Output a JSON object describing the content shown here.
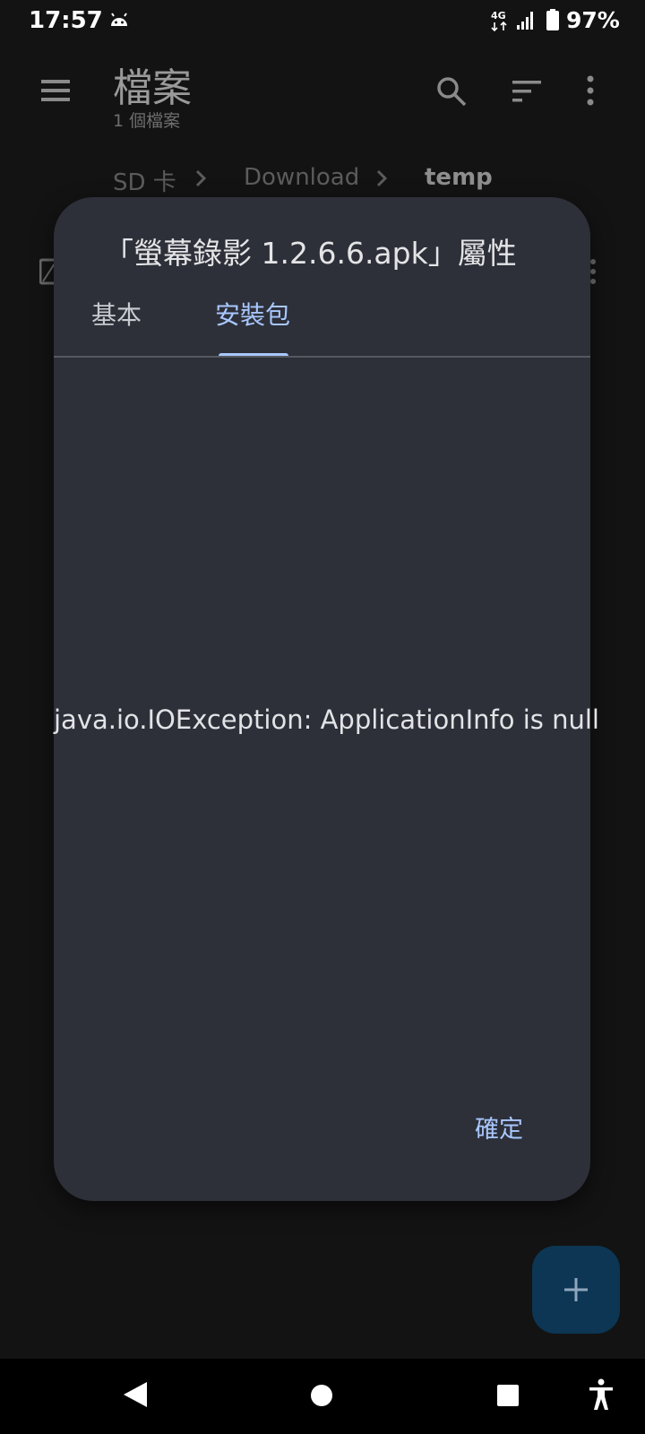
{
  "status_bar": {
    "time": "17:57",
    "network": "4G",
    "battery_percent": "97%"
  },
  "app_bar": {
    "title": "檔案",
    "subtitle": "1 個檔案"
  },
  "breadcrumb": {
    "items": [
      "SD 卡",
      "Download",
      "temp"
    ]
  },
  "dialog": {
    "title": "「螢幕錄影 1.2.6.6.apk」屬性",
    "tabs": [
      {
        "label": "基本",
        "selected": false
      },
      {
        "label": "安裝包",
        "selected": true
      }
    ],
    "message": "java.io.IOException: ApplicationInfo is null",
    "ok_label": "確定"
  },
  "colors": {
    "accent": "#a9c7ff",
    "dialog_bg": "#2d3039",
    "fab_bg": "#0c3654",
    "background": "#131313"
  },
  "icons": {
    "status": [
      "android-icon",
      "network-icon",
      "signal-icon",
      "battery-icon"
    ],
    "app_bar": [
      "menu-icon",
      "search-icon",
      "sort-icon",
      "more-icon"
    ],
    "nav": [
      "back-icon",
      "home-icon",
      "recents-icon",
      "accessibility-icon"
    ],
    "fab": "plus-icon"
  }
}
